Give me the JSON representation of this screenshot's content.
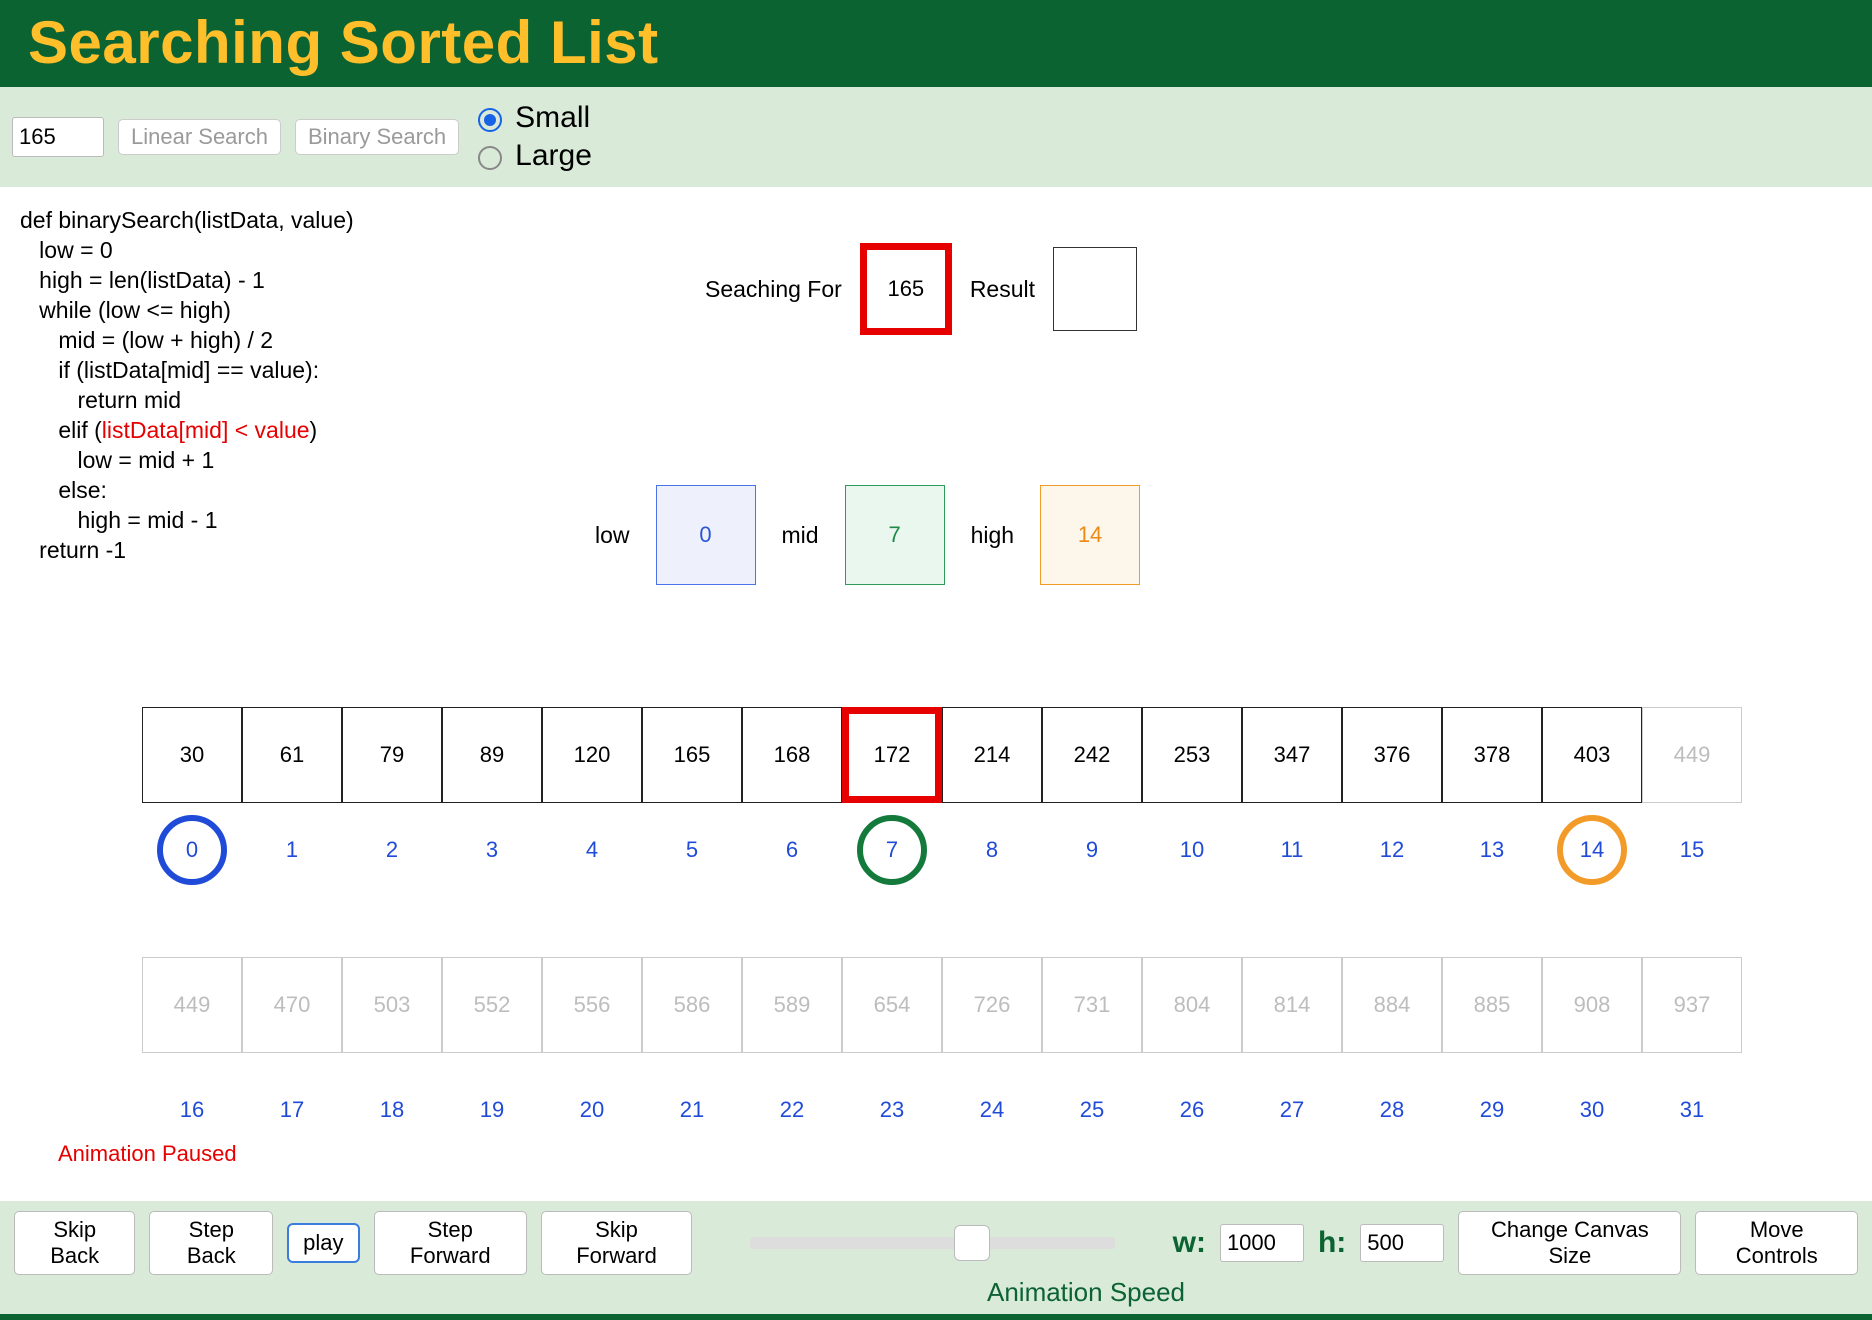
{
  "header": {
    "title": "Searching Sorted List"
  },
  "controls": {
    "search_value": "165",
    "linear_btn": "Linear Search",
    "binary_btn": "Binary Search",
    "size_small": "Small",
    "size_large": "Large",
    "size_selected": "small"
  },
  "code": {
    "lines": [
      "def binarySearch(listData, value)",
      "   low = 0",
      "   high = len(listData) - 1",
      "   while (low <= high)",
      "      mid = (low + high) / 2",
      "      if (listData[mid] == value):",
      "         return mid",
      "      elif (listData[mid] < value)",
      "         low = mid + 1",
      "      else:",
      "         high = mid - 1",
      "   return -1"
    ],
    "highlight_line_index": 7,
    "highlight_fragment": "listData[mid] < value"
  },
  "search": {
    "searching_for_label": "Seaching For",
    "searching_for_value": "165",
    "result_label": "Result",
    "result_value": ""
  },
  "pointers": {
    "low_label": "low",
    "low_value": "0",
    "mid_label": "mid",
    "mid_value": "7",
    "high_label": "high",
    "high_value": "14"
  },
  "array": {
    "row1_values": [
      "30",
      "61",
      "79",
      "89",
      "120",
      "165",
      "168",
      "172",
      "214",
      "242",
      "253",
      "347",
      "376",
      "378",
      "403",
      "449"
    ],
    "row1_indices": [
      "0",
      "1",
      "2",
      "3",
      "4",
      "5",
      "6",
      "7",
      "8",
      "9",
      "10",
      "11",
      "12",
      "13",
      "14",
      "15"
    ],
    "row2_values": [
      "449",
      "470",
      "503",
      "552",
      "556",
      "586",
      "589",
      "654",
      "726",
      "731",
      "804",
      "814",
      "884",
      "885",
      "908",
      "937"
    ],
    "row2_indices": [
      "16",
      "17",
      "18",
      "19",
      "20",
      "21",
      "22",
      "23",
      "24",
      "25",
      "26",
      "27",
      "28",
      "29",
      "30",
      "31"
    ],
    "mid_index": 7,
    "low_index": 0,
    "high_index": 14,
    "dim_from_index": 15
  },
  "status": {
    "text": "Animation Paused"
  },
  "footer": {
    "skip_back": "Skip Back",
    "step_back": "Step Back",
    "play": "play",
    "step_forward": "Step Forward",
    "skip_forward": "Skip Forward",
    "speed_label": "Animation Speed",
    "w_label": "w:",
    "w_value": "1000",
    "h_label": "h:",
    "h_value": "500",
    "change_canvas": "Change Canvas Size",
    "move_controls": "Move Controls"
  },
  "colors": {
    "low": "#1f4bd8",
    "mid": "#137a3c",
    "high": "#f29b28",
    "highlight": "#e60000"
  }
}
